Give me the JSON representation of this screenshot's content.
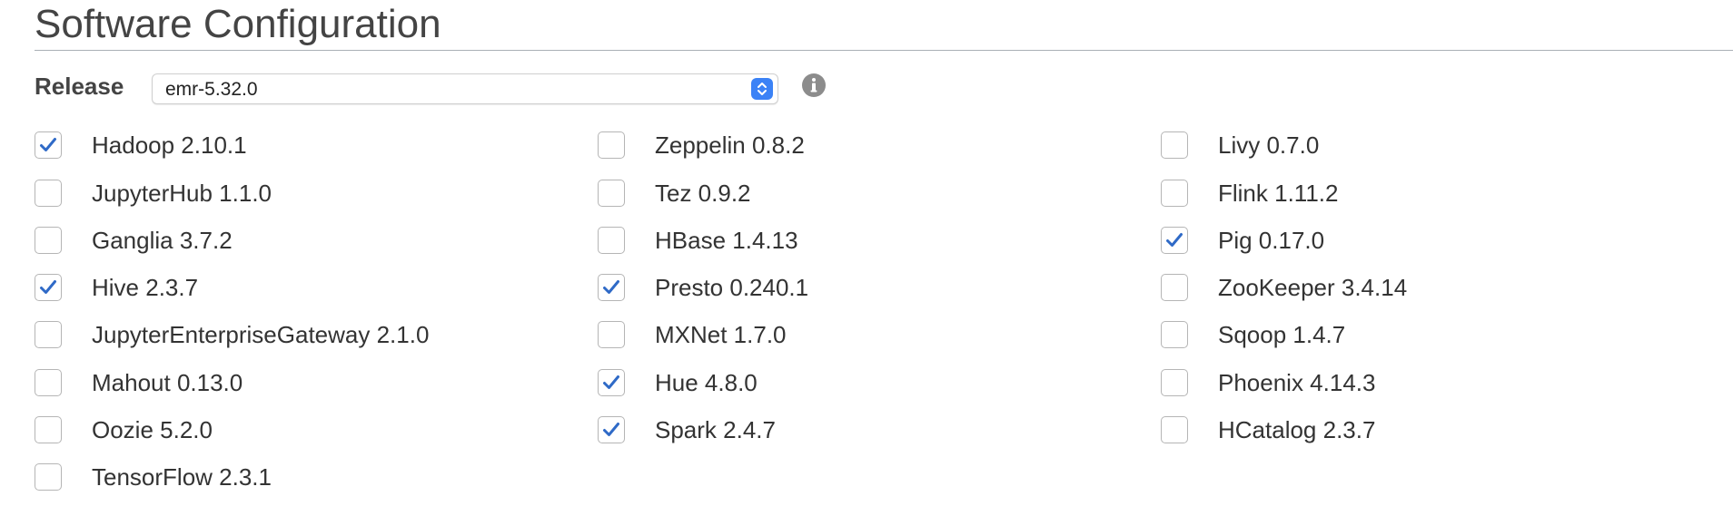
{
  "section": {
    "title": "Software Configuration"
  },
  "release": {
    "label": "Release",
    "selected": "emr-5.32.0"
  },
  "icons": {
    "info": "info-circle-icon",
    "select_stepper": "chevron-updown-icon",
    "check": "checkmark-icon"
  },
  "colors": {
    "check": "#2f6ac7",
    "stepper": "#3b82f6"
  },
  "columns": [
    [
      {
        "label": "Hadoop 2.10.1",
        "checked": true
      },
      {
        "label": "JupyterHub 1.1.0",
        "checked": false
      },
      {
        "label": "Ganglia 3.7.2",
        "checked": false
      },
      {
        "label": "Hive 2.3.7",
        "checked": true
      },
      {
        "label": "JupyterEnterpriseGateway 2.1.0",
        "checked": false
      },
      {
        "label": "Mahout 0.13.0",
        "checked": false
      },
      {
        "label": "Oozie 5.2.0",
        "checked": false
      },
      {
        "label": "TensorFlow 2.3.1",
        "checked": false
      }
    ],
    [
      {
        "label": "Zeppelin 0.8.2",
        "checked": false
      },
      {
        "label": "Tez 0.9.2",
        "checked": false
      },
      {
        "label": "HBase 1.4.13",
        "checked": false
      },
      {
        "label": "Presto 0.240.1",
        "checked": true
      },
      {
        "label": "MXNet 1.7.0",
        "checked": false
      },
      {
        "label": "Hue 4.8.0",
        "checked": true
      },
      {
        "label": "Spark 2.4.7",
        "checked": true
      }
    ],
    [
      {
        "label": "Livy 0.7.0",
        "checked": false
      },
      {
        "label": "Flink 1.11.2",
        "checked": false
      },
      {
        "label": "Pig 0.17.0",
        "checked": true
      },
      {
        "label": "ZooKeeper 3.4.14",
        "checked": false
      },
      {
        "label": "Sqoop 1.4.7",
        "checked": false
      },
      {
        "label": "Phoenix 4.14.3",
        "checked": false
      },
      {
        "label": "HCatalog 2.3.7",
        "checked": false
      }
    ]
  ]
}
